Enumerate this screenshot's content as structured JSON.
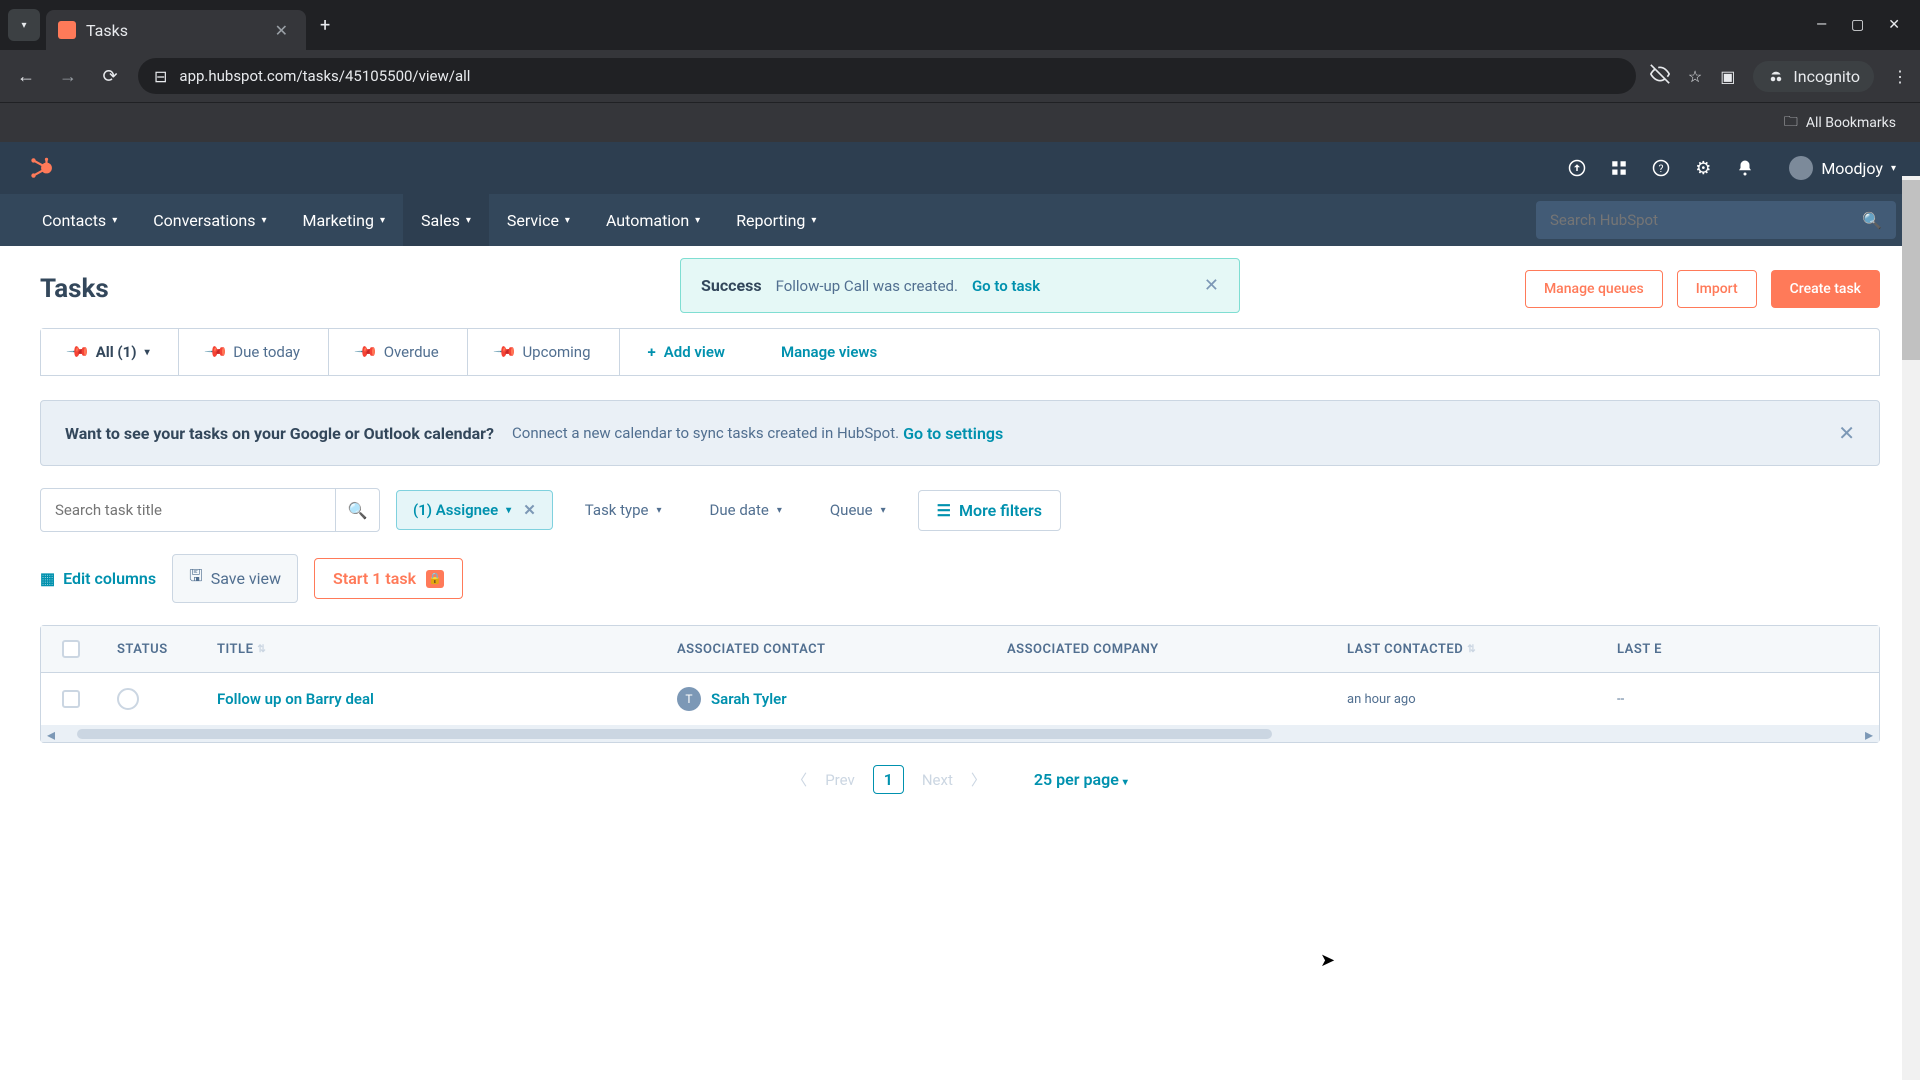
{
  "browser": {
    "tab_title": "Tasks",
    "url": "app.hubspot.com/tasks/45105500/view/all",
    "incognito_label": "Incognito",
    "all_bookmarks": "All Bookmarks"
  },
  "header": {
    "user_name": "Moodjoy"
  },
  "nav": {
    "items": [
      "Contacts",
      "Conversations",
      "Marketing",
      "Sales",
      "Service",
      "Automation",
      "Reporting"
    ],
    "active_index": 3,
    "search_placeholder": "Search HubSpot"
  },
  "page": {
    "title": "Tasks",
    "actions": {
      "manage_queues": "Manage queues",
      "import": "Import",
      "create_task": "Create task"
    }
  },
  "toast": {
    "title": "Success",
    "message": "Follow-up Call was created.",
    "link": "Go to task"
  },
  "tabs": {
    "all": "All (1)",
    "due_today": "Due today",
    "overdue": "Overdue",
    "upcoming": "Upcoming",
    "add_view": "Add view",
    "manage_views": "Manage views"
  },
  "banner": {
    "strong": "Want to see your tasks on your Google or Outlook calendar?",
    "text": "Connect a new calendar to sync tasks created in HubSpot.",
    "link": "Go to settings"
  },
  "filters": {
    "search_placeholder": "Search task title",
    "assignee": "(1) Assignee",
    "task_type": "Task type",
    "due_date": "Due date",
    "queue": "Queue",
    "more": "More filters"
  },
  "actions_row": {
    "edit_columns": "Edit columns",
    "save_view": "Save view",
    "start_task": "Start 1 task"
  },
  "table": {
    "headers": {
      "status": "STATUS",
      "title": "TITLE",
      "contact": "ASSOCIATED CONTACT",
      "company": "ASSOCIATED COMPANY",
      "last_contacted": "LAST CONTACTED",
      "last_e": "LAST E"
    },
    "rows": [
      {
        "title": "Follow up on Barry deal",
        "contact_initial": "T",
        "contact": "Sarah Tyler",
        "company": "",
        "last_contacted": "an hour ago",
        "last_e": "--"
      }
    ]
  },
  "pagination": {
    "prev": "Prev",
    "page": "1",
    "next": "Next",
    "per_page": "25 per page"
  }
}
